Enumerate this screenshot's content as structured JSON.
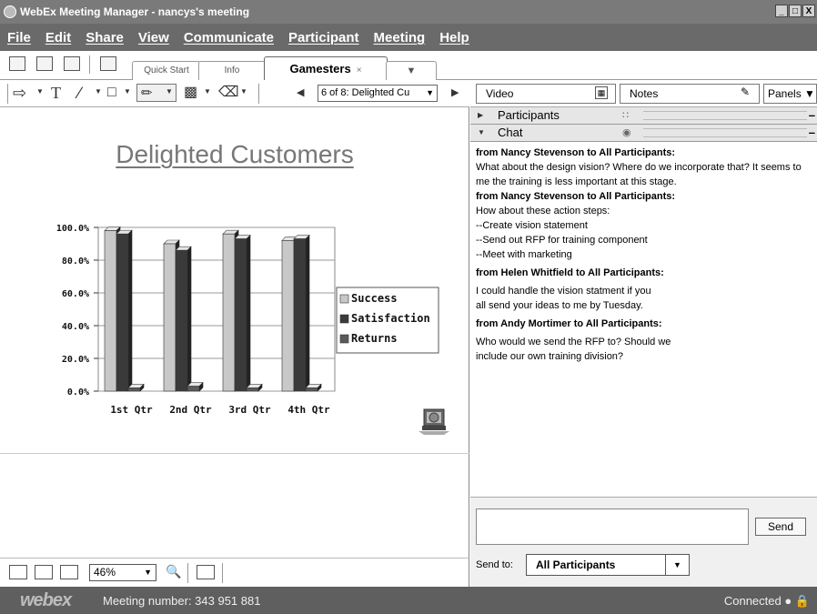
{
  "window": {
    "title": "WebEx Meeting Manager - nancys's meeting",
    "controls": [
      "_",
      "□",
      "X"
    ]
  },
  "menu": [
    "File",
    "Edit",
    "Share",
    "View",
    "Communicate",
    "Participant",
    "Meeting",
    "Help"
  ],
  "tabs": [
    {
      "label": "Quick Start",
      "active": false
    },
    {
      "label": "Info",
      "active": false
    },
    {
      "label": "Gamesters",
      "active": true,
      "close": "×"
    },
    {
      "label": "▼",
      "active": false
    }
  ],
  "annotation": {
    "slide_selector": "6 of 8: Delighted Cu"
  },
  "slide": {
    "title": "Delighted Customers"
  },
  "chart_data": {
    "type": "bar",
    "categories": [
      "1st Qtr",
      "2nd Qtr",
      "3rd Qtr",
      "4th Qtr"
    ],
    "series": [
      {
        "name": "Success",
        "values": [
          98,
          90,
          96,
          92
        ],
        "color": "#c8c8c8"
      },
      {
        "name": "Satisfaction",
        "values": [
          96,
          86,
          93,
          93
        ],
        "color": "#3a3a3a"
      },
      {
        "name": "Returns",
        "values": [
          2,
          3,
          2,
          2
        ],
        "color": "#5a5a5a"
      }
    ],
    "yticks": [
      "0.0%",
      "20.0%",
      "40.0%",
      "60.0%",
      "80.0%",
      "100.0%"
    ],
    "ylim": [
      0,
      100
    ],
    "legend": "right",
    "grid": true
  },
  "slide_tools": {
    "zoom": "46%"
  },
  "status": {
    "logo": "webex",
    "meeting_number": "Meeting number: 343 951 881",
    "connection": "Connected ● 🔒"
  },
  "panels": {
    "video_label": "Video",
    "notes_label": "Notes",
    "panels_label": "Panels ▼",
    "participants_label": "Participants",
    "chat_label": "Chat"
  },
  "chat": {
    "messages": [
      {
        "from": "from Nancy Stevenson to All Participants:",
        "lines": [
          "What about the design vision? Where do we incorporate that? It seems to me the training is less important at this stage."
        ]
      },
      {
        "from": "from Nancy Stevenson to All Participants:",
        "lines": [
          "How about these action steps:",
          "--Create vision statement",
          "--Send out RFP for training component",
          "--Meet with marketing"
        ]
      },
      {
        "from": "from Helen Whitfield to All Participants:",
        "lines": [
          "I could handle the vision statment if you",
          "all send your ideas to me by Tuesday."
        ]
      },
      {
        "from": "from Andy Mortimer to All Participants:",
        "lines": [
          "Who would we send the RFP to? Should we",
          "include our own training division?"
        ]
      }
    ],
    "send_label": "Send",
    "send_to_label": "Send to:",
    "send_to_value": "All Participants"
  }
}
